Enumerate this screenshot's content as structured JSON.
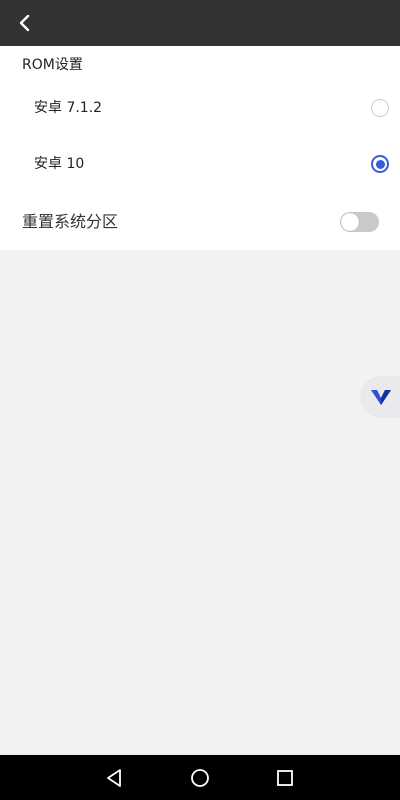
{
  "header": {
    "back_icon": "chevron-left-icon"
  },
  "rom_settings": {
    "title": "ROM设置",
    "options": [
      {
        "label": "安卓 7.1.2",
        "selected": false
      },
      {
        "label": "安卓 10",
        "selected": true
      }
    ]
  },
  "reset_system_partition": {
    "label": "重置系统分区",
    "enabled": false
  },
  "floating_button": {
    "icon": "v-logo-icon"
  },
  "system_nav": {
    "back_icon": "triangle-back-icon",
    "home_icon": "circle-home-icon",
    "recent_icon": "square-recent-icon"
  },
  "colors": {
    "accent": "#3b5bdb",
    "topbar": "#333333",
    "background": "#f2f2f2"
  }
}
